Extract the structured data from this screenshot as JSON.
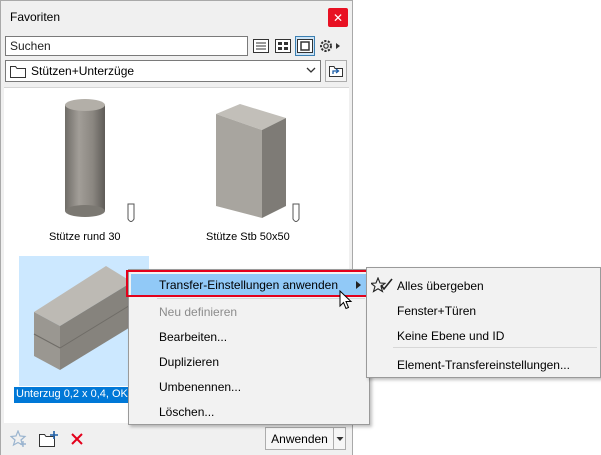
{
  "window": {
    "title": "Favoriten"
  },
  "search": {
    "placeholder": "Suchen"
  },
  "folder": {
    "selected": "Stützen+Unterzüge"
  },
  "items": [
    {
      "label": "Stütze rund 30"
    },
    {
      "label": "Stütze Stb 50x50"
    },
    {
      "label": "Unterzug 0,2 x 0,4, OK"
    }
  ],
  "context_menu": {
    "items": [
      {
        "label": "Transfer-Einstellungen anwenden"
      },
      {
        "label": "Neu definieren"
      },
      {
        "label": "Bearbeiten..."
      },
      {
        "label": "Duplizieren"
      },
      {
        "label": "Umbenennen..."
      },
      {
        "label": "Löschen..."
      }
    ]
  },
  "submenu": {
    "items": [
      {
        "label": "Alles übergeben"
      },
      {
        "label": "Fenster+Türen"
      },
      {
        "label": "Keine Ebene und ID"
      },
      {
        "label": "Element-Transfereinstellungen..."
      }
    ]
  },
  "footer": {
    "apply_label": "Anwenden"
  },
  "colors": {
    "accent": "#0078d7",
    "highlight_border": "#e3001b",
    "menu_hover": "#91c9f7",
    "close": "#e81123"
  }
}
